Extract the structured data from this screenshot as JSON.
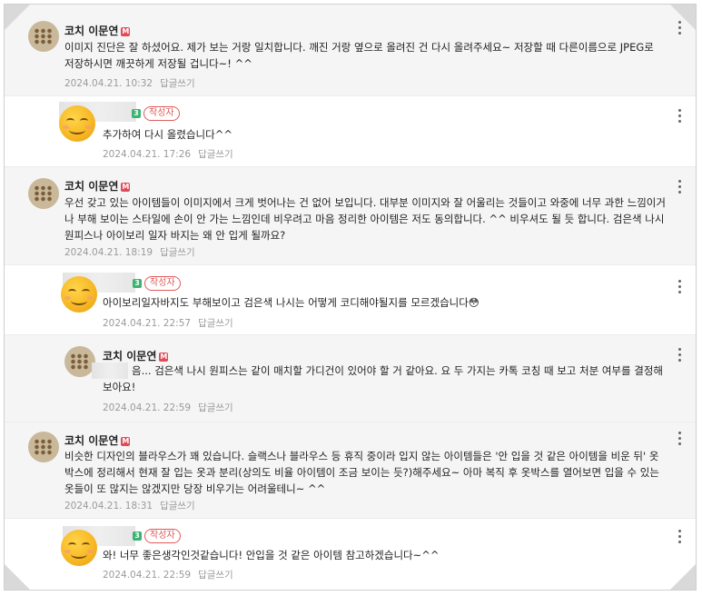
{
  "reply_label": "답글쓰기",
  "author_badge": "작성자",
  "coach_badge": "M",
  "level_badge": "3",
  "comments": [
    {
      "name": "코치 이문연",
      "text": "이미지 진단은 잘 하셨어요. 제가 보는 거랑 일치합니다. 깨진 거랑 옆으로 올려진 건 다시 올려주세요~ 저장할 때 다른이름으로 JPEG로 저장하시면 깨끗하게 저장될 겁니다~! ^^",
      "date": "2024.04.21. 10:32"
    },
    {
      "text": "추가하여 다시 올렸습니다^^",
      "date": "2024.04.21. 17:26"
    },
    {
      "name": "코치 이문연",
      "text": "우선 갖고 있는 아이템들이 이미지에서 크게 벗어나는 건 없어 보입니다. 대부분 이미지와 잘 어울리는 것들이고 와중에 너무 과한 느낌이거나 부해 보이는 스타일에 손이 안 가는 느낌인데 비우려고 마음 정리한 아이템은 저도 동의합니다. ^^ 비우셔도 될 듯 합니다. 검은색 나시 원피스나 아이보리 일자 바지는 왜 안 입게 될까요?",
      "date": "2024.04.21. 18:19"
    },
    {
      "text": "아이보리일자바지도 부해보이고 검은색 나시는 어떻게 코디해야될지를 모르겠습니다😳",
      "date": "2024.04.21. 22:57"
    },
    {
      "name": "코치 이문연",
      "text": "음... 검은색 나시 원피스는 같이 매치할 가디건이 있어야 할 거 같아요. 요 두 가지는 카톡 코칭 때 보고 처분 여부를 결정해보아요!",
      "date": "2024.04.21. 22:59"
    },
    {
      "name": "코치 이문연",
      "text": "비슷한 디자인의 블라우스가 꽤 있습니다. 슬랙스나 블라우스 등 휴직 중이라 입지 않는 아이템들은 '안 입을 것 같은 아이템을 비운 뒤' 옷박스에 정리해서 현재 잘 입는 옷과 분리(상의도 비율 아이템이 조금 보이는 듯?)해주세요~ 아마 복직 후 옷박스를 열어보면 입을 수 있는 옷들이 또 많지는 않겠지만 당장 비우기는 어려울테니~ ^^",
      "date": "2024.04.21. 18:31"
    },
    {
      "text": "와! 너무 좋은생각인것같습니다! 안입을 것 같은 아이템 참고하겠습니다~^^",
      "date": "2024.04.21. 22:59"
    }
  ]
}
